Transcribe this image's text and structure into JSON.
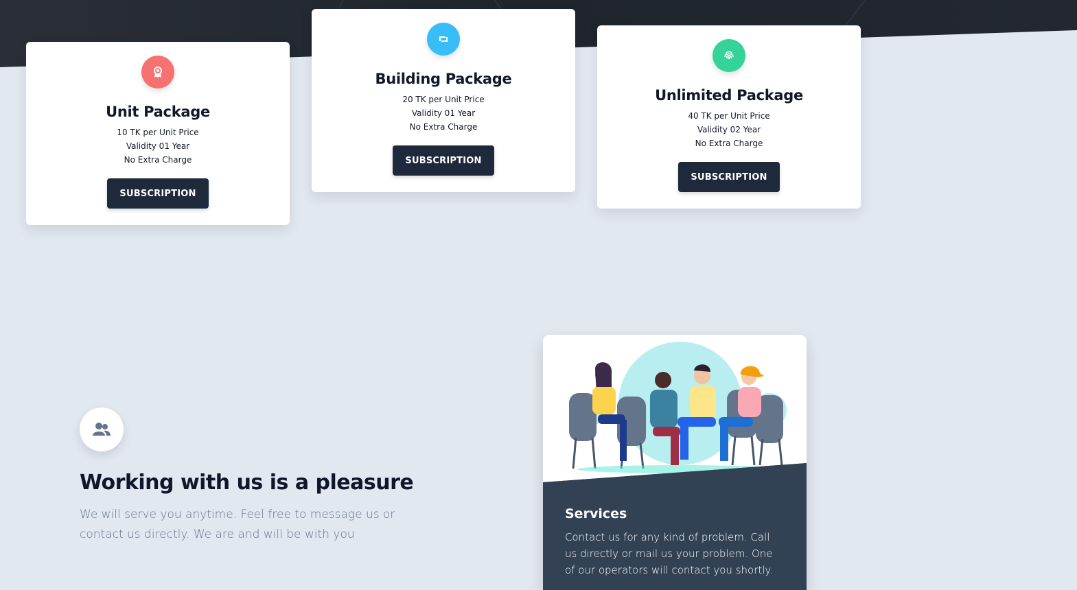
{
  "packages": [
    {
      "id": "unit",
      "icon": "award-icon",
      "icon_color": "#f87171",
      "title": "Unit Package",
      "price": "10 TK per Unit Price",
      "validity": "Validity 01 Year",
      "extra": "No Extra Charge",
      "button": "SUBSCRIPTION"
    },
    {
      "id": "building",
      "icon": "retweet-icon",
      "icon_color": "#38bdf8",
      "title": "Building Package",
      "price": "20 TK per Unit Price",
      "validity": "Validity 01 Year",
      "extra": "No Extra Charge",
      "button": "SUBSCRIPTION"
    },
    {
      "id": "unlimited",
      "icon": "fingerprint-icon",
      "icon_color": "#34d399",
      "title": "Unlimited Package",
      "price": "40 TK per Unit Price",
      "validity": "Validity 02 Year",
      "extra": "No Extra Charge",
      "button": "SUBSCRIPTION"
    }
  ],
  "info": {
    "icon": "user-friends-icon",
    "title": "Working with us is a pleasure",
    "text": "We will serve you anytime. Feel free to message us or contact us directly. We are and will be with you"
  },
  "services": {
    "illustration": "group-meeting-illustration",
    "title": "Services",
    "text": "Contact us for any kind of problem. Call us directly or mail us your problem. One of our operators will contact you shortly."
  },
  "colors": {
    "page_bg": "#e2e8f0",
    "hero_dark": "#1f2937",
    "button_bg": "#1e293b",
    "service_card_bg": "#334155"
  }
}
